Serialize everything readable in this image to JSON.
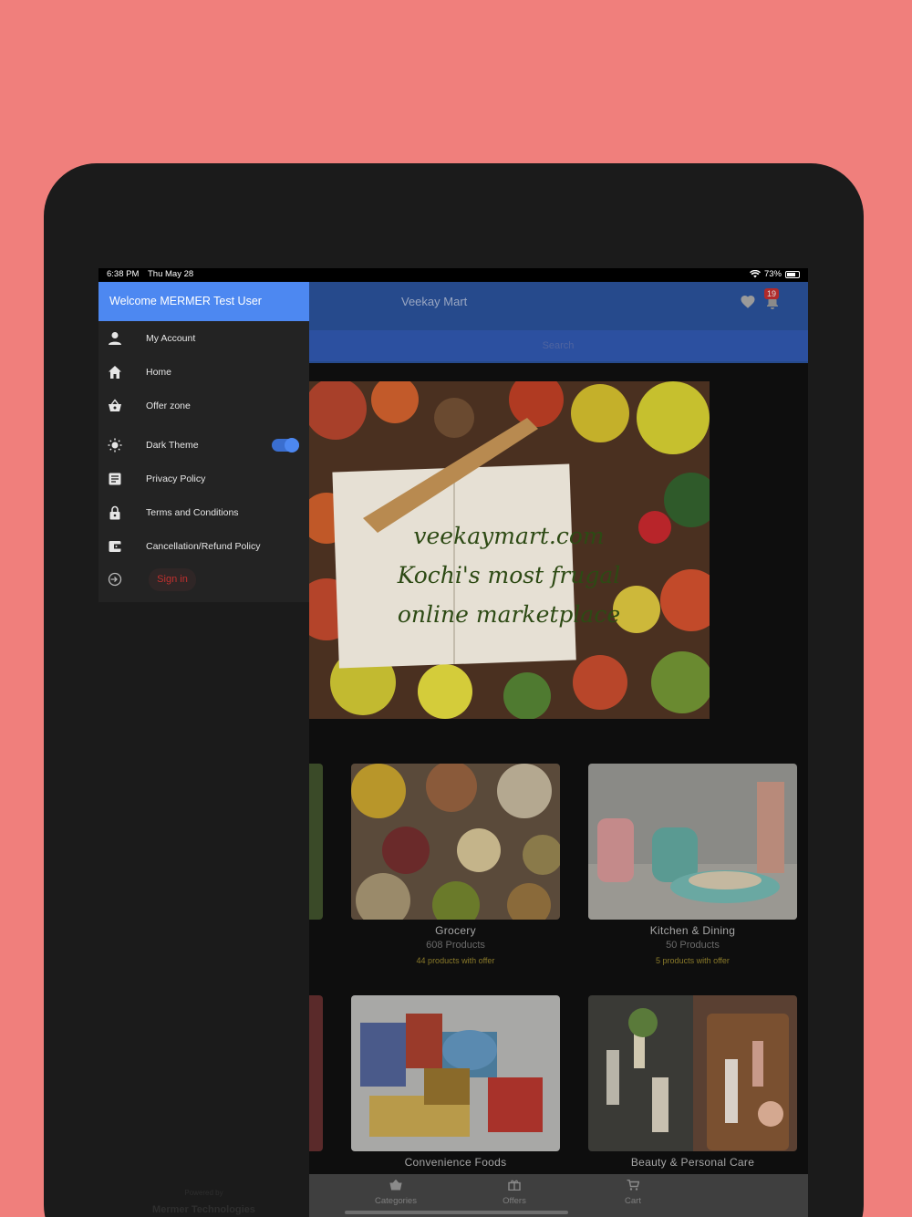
{
  "status": {
    "time": "6:38 PM",
    "date": "Thu May 28",
    "battery": "73%"
  },
  "header": {
    "title": "Veekay Mart",
    "notification_count": "19",
    "search_placeholder": "Search"
  },
  "banner": {
    "line1": "veekaymart.com",
    "line2": "Kochi's most frugal",
    "line3": "online marketplace"
  },
  "categories": [
    {
      "name": "Grocery",
      "count": "608 Products",
      "offer": "44 products with offer"
    },
    {
      "name": "Kitchen & Dining",
      "count": "50 Products",
      "offer": "5 products with offer"
    },
    {
      "name": "Convenience Foods",
      "count": "",
      "offer": ""
    },
    {
      "name": "Beauty & Personal Care",
      "count": "",
      "offer": ""
    }
  ],
  "tabs": [
    {
      "label": "Categories",
      "icon": "basket-icon"
    },
    {
      "label": "Offers",
      "icon": "gift-icon"
    },
    {
      "label": "Cart",
      "icon": "cart-icon"
    }
  ],
  "drawer": {
    "welcome": "Welcome MERMER Test User",
    "items": [
      {
        "label": "My Account",
        "icon": "person-icon"
      },
      {
        "label": "Home",
        "icon": "home-icon"
      },
      {
        "label": "Offer zone",
        "icon": "basket-icon"
      },
      {
        "label": "Dark Theme",
        "icon": "sun-icon"
      },
      {
        "label": "Privacy Policy",
        "icon": "document-icon"
      },
      {
        "label": "Terms and Conditions",
        "icon": "lock-icon"
      },
      {
        "label": "Cancellation/Refund Policy",
        "icon": "wallet-icon"
      }
    ],
    "dark_theme_on": true,
    "signin_label": "Sign in",
    "powered_by": "Powered by",
    "company": "Mermer Technologies"
  },
  "colors": {
    "background": "#f07f7c",
    "header": "#264a8c",
    "drawer_header": "#4d88f1",
    "signin_text": "#c0302e"
  }
}
